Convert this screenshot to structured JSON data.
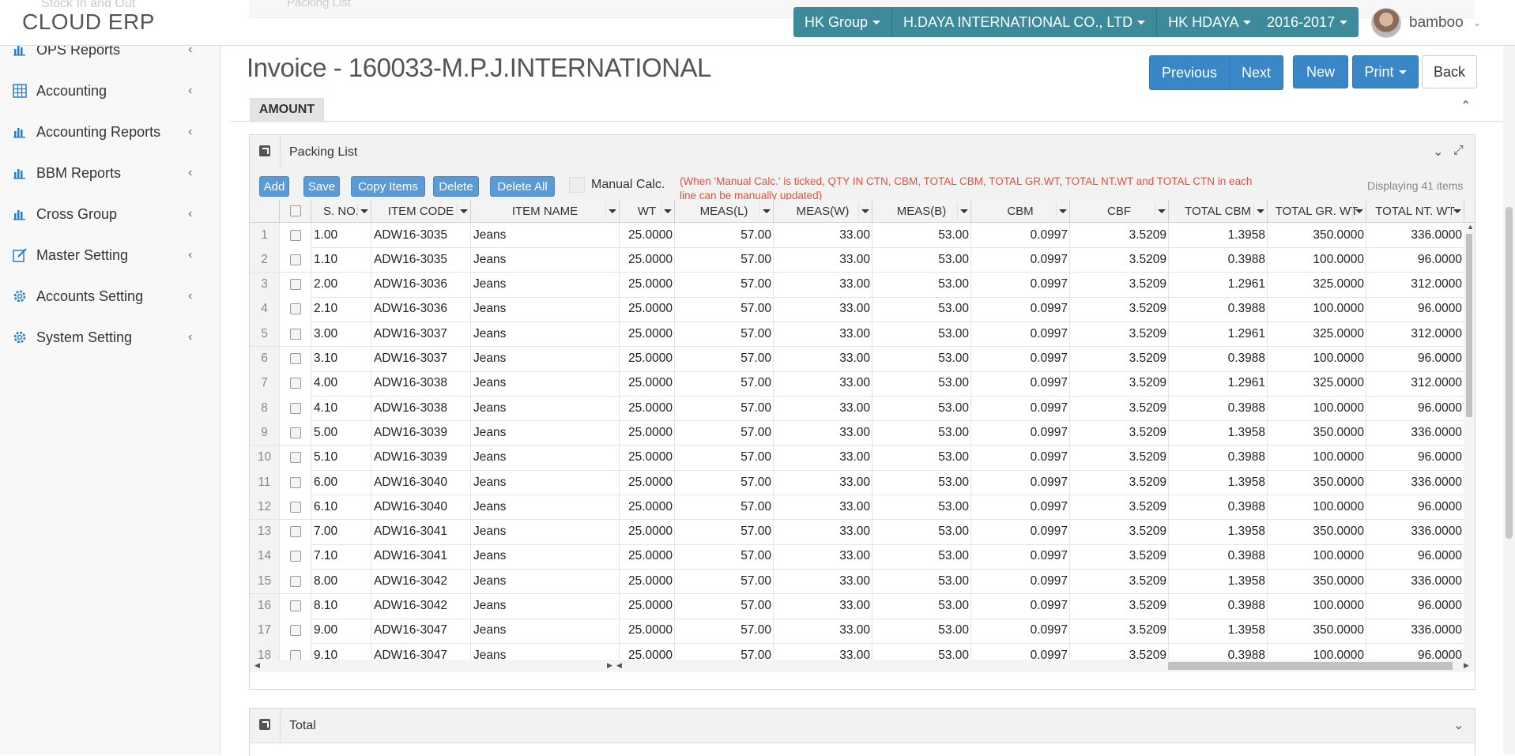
{
  "app": {
    "brand": "CLOUD ERP",
    "ghost_sidebar": "Stock In and Out",
    "ghost_panel": "Packing List"
  },
  "topnav": {
    "group": "HK Group",
    "company": "H.DAYA INTERNATIONAL CO., LTD",
    "branch": "HK HDAYA",
    "year": "2016-2017",
    "user": "bamboo",
    "color": "#3d8a9a"
  },
  "sidebar": {
    "items": [
      {
        "label": "OPS Reports",
        "icon": "bar-chart-icon"
      },
      {
        "label": "Accounting",
        "icon": "grid-icon"
      },
      {
        "label": "Accounting Reports",
        "icon": "bar-chart-icon"
      },
      {
        "label": "BBM Reports",
        "icon": "bar-chart-icon"
      },
      {
        "label": "Cross Group",
        "icon": "bar-chart-icon"
      },
      {
        "label": "Master Setting",
        "icon": "edit-icon"
      },
      {
        "label": "Accounts Setting",
        "icon": "gear-icon"
      },
      {
        "label": "System Setting",
        "icon": "gear-icon"
      }
    ]
  },
  "page": {
    "title": "Invoice - 160033-M.P.J.INTERNATIONAL",
    "prev": "Previous",
    "next": "Next",
    "new": "New",
    "print": "Print",
    "back": "Back",
    "amount_tab": "AMOUNT",
    "accent": "#3a87c8"
  },
  "packing": {
    "title": "Packing List",
    "buttons": {
      "add": "Add",
      "save": "Save",
      "copy": "Copy Items",
      "delete": "Delete",
      "delete_all": "Delete All"
    },
    "manual_label": "Manual Calc.",
    "note": "(When 'Manual Calc.' is ticked, QTY IN CTN, CBM, TOTAL CBM, TOTAL GR.WT, TOTAL NT.WT and TOTAL CTN in each line can be manually updated)",
    "displaying": "Displaying 41 items",
    "columns": [
      "S. NO.",
      "ITEM CODE",
      "ITEM NAME",
      "WT",
      "MEAS(L)",
      "MEAS(W)",
      "MEAS(B)",
      "CBM",
      "CBF",
      "TOTAL CBM",
      "TOTAL GR. WT",
      "TOTAL NT. WT"
    ],
    "rows": [
      [
        "1",
        "1.00",
        "ADW16-3035",
        "Jeans",
        "25.0000",
        "57.00",
        "33.00",
        "53.00",
        "0.0997",
        "3.5209",
        "1.3958",
        "350.0000",
        "336.0000"
      ],
      [
        "2",
        "1.10",
        "ADW16-3035",
        "Jeans",
        "25.0000",
        "57.00",
        "33.00",
        "53.00",
        "0.0997",
        "3.5209",
        "0.3988",
        "100.0000",
        "96.0000"
      ],
      [
        "3",
        "2.00",
        "ADW16-3036",
        "Jeans",
        "25.0000",
        "57.00",
        "33.00",
        "53.00",
        "0.0997",
        "3.5209",
        "1.2961",
        "325.0000",
        "312.0000"
      ],
      [
        "4",
        "2.10",
        "ADW16-3036",
        "Jeans",
        "25.0000",
        "57.00",
        "33.00",
        "53.00",
        "0.0997",
        "3.5209",
        "0.3988",
        "100.0000",
        "96.0000"
      ],
      [
        "5",
        "3.00",
        "ADW16-3037",
        "Jeans",
        "25.0000",
        "57.00",
        "33.00",
        "53.00",
        "0.0997",
        "3.5209",
        "1.2961",
        "325.0000",
        "312.0000"
      ],
      [
        "6",
        "3.10",
        "ADW16-3037",
        "Jeans",
        "25.0000",
        "57.00",
        "33.00",
        "53.00",
        "0.0997",
        "3.5209",
        "0.3988",
        "100.0000",
        "96.0000"
      ],
      [
        "7",
        "4.00",
        "ADW16-3038",
        "Jeans",
        "25.0000",
        "57.00",
        "33.00",
        "53.00",
        "0.0997",
        "3.5209",
        "1.2961",
        "325.0000",
        "312.0000"
      ],
      [
        "8",
        "4.10",
        "ADW16-3038",
        "Jeans",
        "25.0000",
        "57.00",
        "33.00",
        "53.00",
        "0.0997",
        "3.5209",
        "0.3988",
        "100.0000",
        "96.0000"
      ],
      [
        "9",
        "5.00",
        "ADW16-3039",
        "Jeans",
        "25.0000",
        "57.00",
        "33.00",
        "53.00",
        "0.0997",
        "3.5209",
        "1.3958",
        "350.0000",
        "336.0000"
      ],
      [
        "10",
        "5.10",
        "ADW16-3039",
        "Jeans",
        "25.0000",
        "57.00",
        "33.00",
        "53.00",
        "0.0997",
        "3.5209",
        "0.3988",
        "100.0000",
        "96.0000"
      ],
      [
        "11",
        "6.00",
        "ADW16-3040",
        "Jeans",
        "25.0000",
        "57.00",
        "33.00",
        "53.00",
        "0.0997",
        "3.5209",
        "1.3958",
        "350.0000",
        "336.0000"
      ],
      [
        "12",
        "6.10",
        "ADW16-3040",
        "Jeans",
        "25.0000",
        "57.00",
        "33.00",
        "53.00",
        "0.0997",
        "3.5209",
        "0.3988",
        "100.0000",
        "96.0000"
      ],
      [
        "13",
        "7.00",
        "ADW16-3041",
        "Jeans",
        "25.0000",
        "57.00",
        "33.00",
        "53.00",
        "0.0997",
        "3.5209",
        "1.3958",
        "350.0000",
        "336.0000"
      ],
      [
        "14",
        "7.10",
        "ADW16-3041",
        "Jeans",
        "25.0000",
        "57.00",
        "33.00",
        "53.00",
        "0.0997",
        "3.5209",
        "0.3988",
        "100.0000",
        "96.0000"
      ],
      [
        "15",
        "8.00",
        "ADW16-3042",
        "Jeans",
        "25.0000",
        "57.00",
        "33.00",
        "53.00",
        "0.0997",
        "3.5209",
        "1.3958",
        "350.0000",
        "336.0000"
      ],
      [
        "16",
        "8.10",
        "ADW16-3042",
        "Jeans",
        "25.0000",
        "57.00",
        "33.00",
        "53.00",
        "0.0997",
        "3.5209",
        "0.3988",
        "100.0000",
        "96.0000"
      ],
      [
        "17",
        "9.00",
        "ADW16-3047",
        "Jeans",
        "25.0000",
        "57.00",
        "33.00",
        "53.00",
        "0.0997",
        "3.5209",
        "1.3958",
        "350.0000",
        "336.0000"
      ],
      [
        "18",
        "9.10",
        "ADW16-3047",
        "Jeans",
        "25.0000",
        "57.00",
        "33.00",
        "53.00",
        "0.0997",
        "3.5209",
        "0.3988",
        "100.0000",
        "96.0000"
      ]
    ]
  },
  "total": {
    "title": "Total"
  }
}
